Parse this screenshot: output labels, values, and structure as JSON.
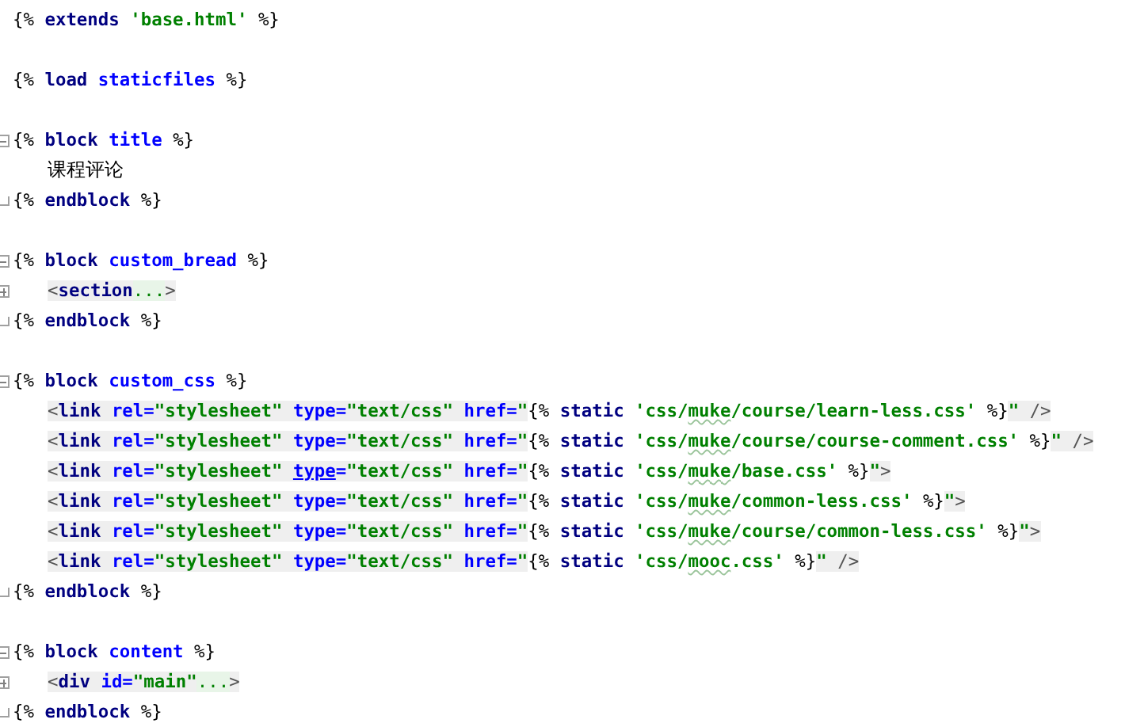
{
  "editor": {
    "items": [
      {
        "kind": "line",
        "tokens": [
          {
            "kind": "tpl",
            "text": "{% "
          },
          {
            "kind": "keyword",
            "text": "extends "
          },
          {
            "kind": "string",
            "text": "'base.html'"
          },
          {
            "kind": "tpl",
            "text": " %}"
          }
        ]
      },
      {
        "kind": "blank"
      },
      {
        "kind": "line",
        "tokens": [
          {
            "kind": "tpl",
            "text": "{% "
          },
          {
            "kind": "keyword",
            "text": "load "
          },
          {
            "kind": "name",
            "text": "staticfiles"
          },
          {
            "kind": "tpl",
            "text": " %}"
          }
        ]
      },
      {
        "kind": "blank"
      },
      {
        "kind": "block",
        "expanded": true,
        "open": [
          {
            "kind": "tpl",
            "text": "{% "
          },
          {
            "kind": "keyword",
            "text": "block "
          },
          {
            "kind": "name",
            "text": "title"
          },
          {
            "kind": "tpl",
            "text": " %}"
          }
        ],
        "children": [
          {
            "kind": "line",
            "tokens": [
              {
                "kind": "text",
                "text": "课程评论"
              }
            ]
          }
        ],
        "close": [
          {
            "kind": "tpl",
            "text": "{% "
          },
          {
            "kind": "keyword",
            "text": "endblock"
          },
          {
            "kind": "tpl",
            "text": " %}"
          }
        ]
      },
      {
        "kind": "blank"
      },
      {
        "kind": "block",
        "expanded": true,
        "open": [
          {
            "kind": "tpl",
            "text": "{% "
          },
          {
            "kind": "keyword",
            "text": "block "
          },
          {
            "kind": "name",
            "text": "custom_bread"
          },
          {
            "kind": "tpl",
            "text": " %}"
          }
        ],
        "children": [
          {
            "kind": "folded",
            "tokens": [
              {
                "kind": "html-punct",
                "text": "<"
              },
              {
                "kind": "html-tag",
                "text": "section"
              },
              {
                "kind": "ellipsis",
                "text": "..."
              },
              {
                "kind": "html-punct",
                "text": ">"
              }
            ]
          }
        ],
        "close": [
          {
            "kind": "tpl",
            "text": "{% "
          },
          {
            "kind": "keyword",
            "text": "endblock"
          },
          {
            "kind": "tpl",
            "text": " %}"
          }
        ]
      },
      {
        "kind": "blank"
      },
      {
        "kind": "block",
        "expanded": true,
        "open": [
          {
            "kind": "tpl",
            "text": "{% "
          },
          {
            "kind": "keyword",
            "text": "block "
          },
          {
            "kind": "name",
            "text": "custom_css"
          },
          {
            "kind": "tpl",
            "text": " %}"
          }
        ],
        "children": [
          {
            "kind": "line",
            "tokens": [
              {
                "kind": "html-punct",
                "text": "<"
              },
              {
                "kind": "html-tag",
                "text": "link "
              },
              {
                "kind": "html-attr",
                "text": "rel="
              },
              {
                "kind": "html-value",
                "text": "\"stylesheet\" "
              },
              {
                "kind": "html-attr",
                "text": "type="
              },
              {
                "kind": "html-value",
                "text": "\"text/css\" "
              },
              {
                "kind": "html-attr",
                "text": "href="
              },
              {
                "kind": "html-value",
                "text": "\""
              },
              {
                "kind": "tpl",
                "text": "{% "
              },
              {
                "kind": "keyword",
                "text": "static "
              },
              {
                "kind": "string",
                "text": "'css/"
              },
              {
                "kind": "string",
                "text": "muke",
                "typo": true
              },
              {
                "kind": "string",
                "text": "/course/learn-less.css'"
              },
              {
                "kind": "tpl",
                "text": " %}"
              },
              {
                "kind": "html-value",
                "text": "\""
              },
              {
                "kind": "html-punct",
                "text": " />"
              }
            ]
          },
          {
            "kind": "line",
            "tokens": [
              {
                "kind": "html-punct",
                "text": "<"
              },
              {
                "kind": "html-tag",
                "text": "link "
              },
              {
                "kind": "html-attr",
                "text": "rel="
              },
              {
                "kind": "html-value",
                "text": "\"stylesheet\" "
              },
              {
                "kind": "html-attr",
                "text": "type="
              },
              {
                "kind": "html-value",
                "text": "\"text/css\" "
              },
              {
                "kind": "html-attr",
                "text": "href="
              },
              {
                "kind": "html-value",
                "text": "\""
              },
              {
                "kind": "tpl",
                "text": "{% "
              },
              {
                "kind": "keyword",
                "text": "static "
              },
              {
                "kind": "string",
                "text": "'css/"
              },
              {
                "kind": "string",
                "text": "muke",
                "typo": true
              },
              {
                "kind": "string",
                "text": "/course/course-comment.css'"
              },
              {
                "kind": "tpl",
                "text": " %}"
              },
              {
                "kind": "html-value",
                "text": "\""
              },
              {
                "kind": "html-punct",
                "text": " />"
              }
            ]
          },
          {
            "kind": "line",
            "tokens": [
              {
                "kind": "html-punct",
                "text": "<"
              },
              {
                "kind": "html-tag",
                "text": "link "
              },
              {
                "kind": "html-attr",
                "text": "rel="
              },
              {
                "kind": "html-value",
                "text": "\"stylesheet\" "
              },
              {
                "kind": "html-attr",
                "text": "type",
                "underlined": true
              },
              {
                "kind": "html-attr",
                "text": "="
              },
              {
                "kind": "html-value",
                "text": "\"text/css\" "
              },
              {
                "kind": "html-attr",
                "text": "href="
              },
              {
                "kind": "html-value",
                "text": "\""
              },
              {
                "kind": "tpl",
                "text": "{% "
              },
              {
                "kind": "keyword",
                "text": "static "
              },
              {
                "kind": "string",
                "text": "'css/"
              },
              {
                "kind": "string",
                "text": "muke",
                "typo": true
              },
              {
                "kind": "string",
                "text": "/base.css'"
              },
              {
                "kind": "tpl",
                "text": " %}"
              },
              {
                "kind": "html-value",
                "text": "\""
              },
              {
                "kind": "html-punct",
                "text": ">"
              }
            ]
          },
          {
            "kind": "line",
            "tokens": [
              {
                "kind": "html-punct",
                "text": "<"
              },
              {
                "kind": "html-tag",
                "text": "link "
              },
              {
                "kind": "html-attr",
                "text": "rel="
              },
              {
                "kind": "html-value",
                "text": "\"stylesheet\" "
              },
              {
                "kind": "html-attr",
                "text": "type="
              },
              {
                "kind": "html-value",
                "text": "\"text/css\" "
              },
              {
                "kind": "html-attr",
                "text": "href="
              },
              {
                "kind": "html-value",
                "text": "\""
              },
              {
                "kind": "tpl",
                "text": "{% "
              },
              {
                "kind": "keyword",
                "text": "static "
              },
              {
                "kind": "string",
                "text": "'css/"
              },
              {
                "kind": "string",
                "text": "muke",
                "typo": true
              },
              {
                "kind": "string",
                "text": "/common-less.css'"
              },
              {
                "kind": "tpl",
                "text": " %}"
              },
              {
                "kind": "html-value",
                "text": "\""
              },
              {
                "kind": "html-punct",
                "text": ">"
              }
            ]
          },
          {
            "kind": "line",
            "tokens": [
              {
                "kind": "html-punct",
                "text": "<"
              },
              {
                "kind": "html-tag",
                "text": "link "
              },
              {
                "kind": "html-attr",
                "text": "rel="
              },
              {
                "kind": "html-value",
                "text": "\"stylesheet\" "
              },
              {
                "kind": "html-attr",
                "text": "type="
              },
              {
                "kind": "html-value",
                "text": "\"text/css\" "
              },
              {
                "kind": "html-attr",
                "text": "href="
              },
              {
                "kind": "html-value",
                "text": "\""
              },
              {
                "kind": "tpl",
                "text": "{% "
              },
              {
                "kind": "keyword",
                "text": "static "
              },
              {
                "kind": "string",
                "text": "'css/"
              },
              {
                "kind": "string",
                "text": "muke",
                "typo": true
              },
              {
                "kind": "string",
                "text": "/course/common-less.css'"
              },
              {
                "kind": "tpl",
                "text": " %}"
              },
              {
                "kind": "html-value",
                "text": "\""
              },
              {
                "kind": "html-punct",
                "text": ">"
              }
            ]
          },
          {
            "kind": "line",
            "tokens": [
              {
                "kind": "html-punct",
                "text": "<"
              },
              {
                "kind": "html-tag",
                "text": "link "
              },
              {
                "kind": "html-attr",
                "text": "rel="
              },
              {
                "kind": "html-value",
                "text": "\"stylesheet\" "
              },
              {
                "kind": "html-attr",
                "text": "type="
              },
              {
                "kind": "html-value",
                "text": "\"text/css\" "
              },
              {
                "kind": "html-attr",
                "text": "href="
              },
              {
                "kind": "html-value",
                "text": "\""
              },
              {
                "kind": "tpl",
                "text": "{% "
              },
              {
                "kind": "keyword",
                "text": "static "
              },
              {
                "kind": "string",
                "text": "'css/"
              },
              {
                "kind": "string",
                "text": "mooc",
                "typo": true
              },
              {
                "kind": "string",
                "text": ".css'"
              },
              {
                "kind": "tpl",
                "text": " %}"
              },
              {
                "kind": "html-value",
                "text": "\""
              },
              {
                "kind": "html-punct",
                "text": " />"
              }
            ]
          }
        ],
        "close": [
          {
            "kind": "tpl",
            "text": "{% "
          },
          {
            "kind": "keyword",
            "text": "endblock"
          },
          {
            "kind": "tpl",
            "text": " %}"
          }
        ]
      },
      {
        "kind": "blank"
      },
      {
        "kind": "block",
        "expanded": true,
        "open": [
          {
            "kind": "tpl",
            "text": "{% "
          },
          {
            "kind": "keyword",
            "text": "block "
          },
          {
            "kind": "name",
            "text": "content"
          },
          {
            "kind": "tpl",
            "text": " %}"
          }
        ],
        "children": [
          {
            "kind": "folded",
            "tokens": [
              {
                "kind": "html-punct",
                "text": "<"
              },
              {
                "kind": "html-tag",
                "text": "div "
              },
              {
                "kind": "html-attr",
                "text": "id="
              },
              {
                "kind": "html-value",
                "text": "\"main\""
              },
              {
                "kind": "ellipsis",
                "text": "..."
              },
              {
                "kind": "html-punct",
                "text": ">"
              }
            ]
          }
        ],
        "close": [
          {
            "kind": "tpl",
            "text": "{% "
          },
          {
            "kind": "keyword",
            "text": "endblock"
          },
          {
            "kind": "tpl",
            "text": " %}"
          }
        ]
      }
    ]
  }
}
